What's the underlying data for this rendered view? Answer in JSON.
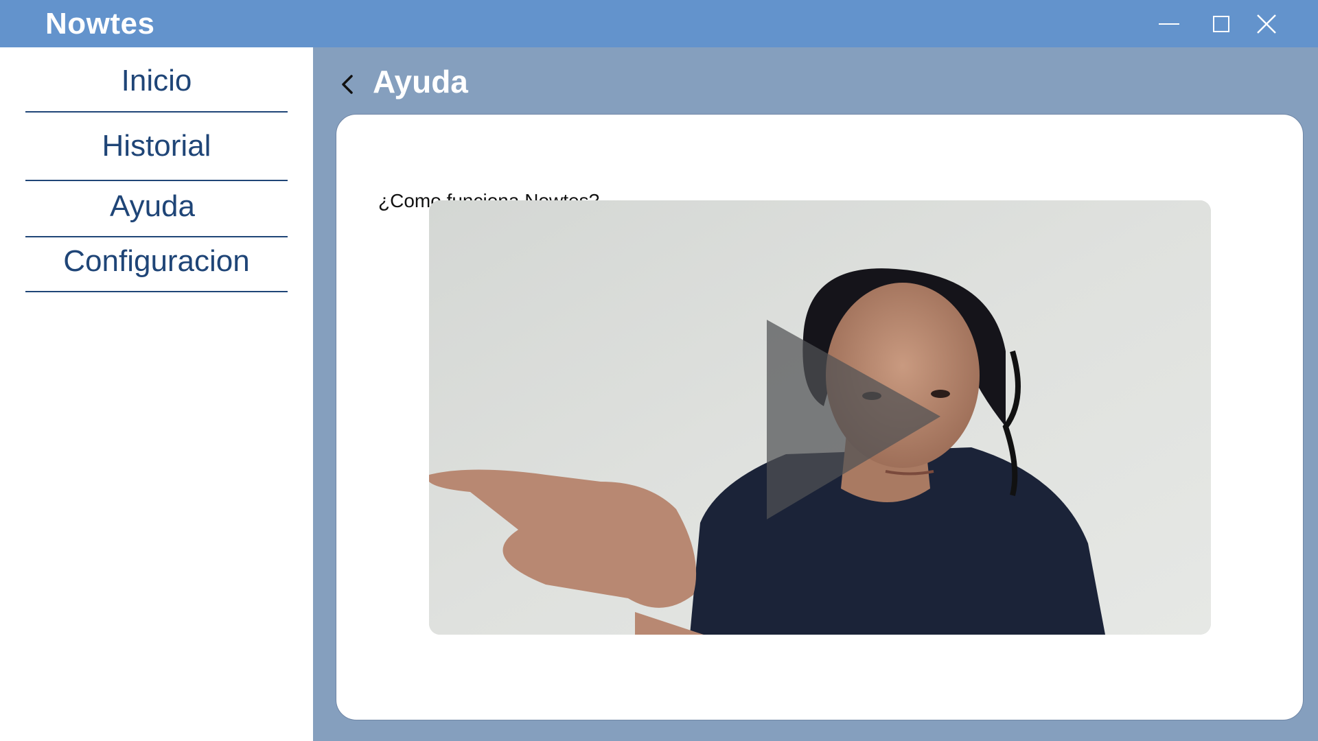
{
  "window": {
    "title": "Nowtes",
    "controls": [
      "minimize-icon",
      "maximize-icon",
      "close-icon"
    ]
  },
  "sidebar": {
    "items": [
      {
        "label": "Inicio"
      },
      {
        "label": "Historial"
      },
      {
        "label": "Ayuda"
      },
      {
        "label": "Configuracion"
      }
    ]
  },
  "header": {
    "back_icon": "chevron-left-icon",
    "title": "Ayuda"
  },
  "content": {
    "question": "¿Como funciona Nowtes?",
    "video": {
      "play_icon": "play-icon"
    }
  },
  "colors": {
    "titlebar": "#6393cc",
    "main_bg": "#859fbe",
    "nav_text": "#1f4577",
    "card_bg": "#ffffff"
  }
}
